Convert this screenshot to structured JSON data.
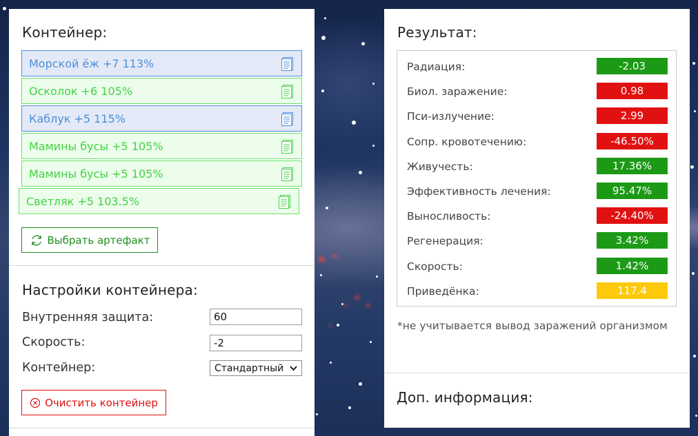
{
  "colors": {
    "green": "#1c9a16",
    "red": "#e11111",
    "yellow": "#fdc90a",
    "artifact_blue": "#4a8fdc",
    "artifact_green": "#45d145"
  },
  "container_section": {
    "title": "Контейнер:",
    "artifacts": [
      {
        "name": "Морской ёж +7 113%",
        "style": "blue",
        "icon": "document-icon"
      },
      {
        "name": "Осколок +6 105%",
        "style": "green",
        "icon": "document-icon"
      },
      {
        "name": "Каблук +5 115%",
        "style": "blue",
        "icon": "document-icon"
      },
      {
        "name": "Мамины бусы +5 105%",
        "style": "green",
        "icon": "document-icon"
      },
      {
        "name": "Мамины бусы +5 105%",
        "style": "green",
        "icon": "document-icon"
      },
      {
        "name": "Светляк +5 103.5%",
        "style": "green",
        "icon": "document-icon"
      }
    ],
    "select_button_label": "Выбрать артефакт",
    "select_button_icon": "refresh-icon"
  },
  "settings_section": {
    "title": "Настройки контейнера:",
    "internal_protection_label": "Внутренняя защита:",
    "internal_protection_value": "60",
    "speed_label": "Скорость:",
    "speed_value": "-2",
    "container_label": "Контейнер:",
    "container_selected": "Стандартный",
    "clear_button_label": "Очистить контейнер",
    "clear_button_icon": "close-circle-icon"
  },
  "result_section": {
    "title": "Результат:",
    "rows": [
      {
        "label": "Радиация:",
        "value": "-2.03",
        "status": "green"
      },
      {
        "label": "Биол. заражение:",
        "value": "0.98",
        "status": "red"
      },
      {
        "label": "Пси-излучение:",
        "value": "2.99",
        "status": "red"
      },
      {
        "label": "Сопр. кровотечению:",
        "value": "-46.50%",
        "status": "red"
      },
      {
        "label": "Живучесть:",
        "value": "17.36%",
        "status": "green"
      },
      {
        "label": "Эффективность лечения:",
        "value": "95.47%",
        "status": "green"
      },
      {
        "label": "Выносливость:",
        "value": "-24.40%",
        "status": "red"
      },
      {
        "label": "Регенерация:",
        "value": "3.42%",
        "status": "green"
      },
      {
        "label": "Скорость:",
        "value": "1.42%",
        "status": "green"
      },
      {
        "label": "Приведёнка:",
        "value": "117.4",
        "status": "yellow"
      }
    ],
    "footnote": "*не учитывается вывод заражений организмом"
  },
  "extra_section": {
    "title": "Доп. информация:"
  }
}
